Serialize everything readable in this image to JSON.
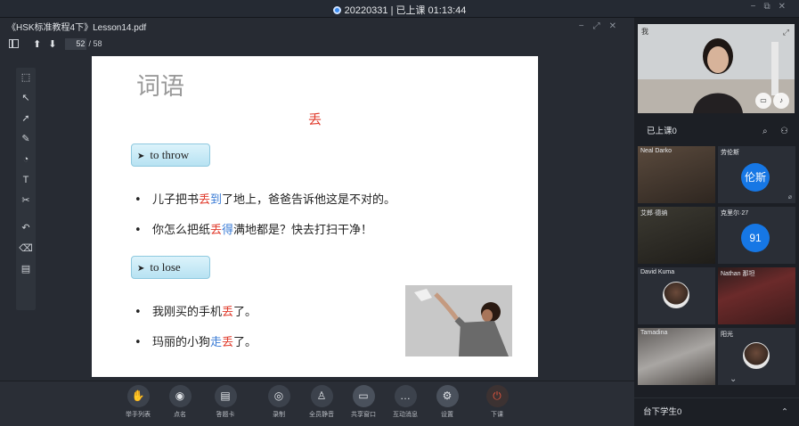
{
  "titlebar": {
    "session": "20220331 | 已上课 01:13:44"
  },
  "pdf": {
    "filename": "《HSK标准教程4下》Lesson14.pdf",
    "page_current": "52",
    "page_total": "/ 58"
  },
  "slide": {
    "title": "词语",
    "word": "丢",
    "meaning1": "to throw",
    "meaning2": "to lose",
    "s1": {
      "a": "儿子把书",
      "b": "丢",
      "c": "到",
      "d": "了地上，爸爸告诉他这是不对的。"
    },
    "s2": {
      "a": "你怎么把纸",
      "b": "丢",
      "c": "得",
      "d": "满地都是？快去打扫干净！"
    },
    "s3": {
      "a": "我刚买的手机",
      "b": "丢",
      "d": "了。"
    },
    "s4": {
      "a": "玛丽的小狗",
      "c": "走",
      "b": "丢",
      "d": "了。"
    }
  },
  "bottombar": {
    "items": [
      {
        "label": "举手列表",
        "icon": "hand-icon"
      },
      {
        "label": "点名",
        "icon": "location-icon"
      },
      {
        "label": "答题卡",
        "icon": "answer-card-icon"
      },
      {
        "label": "录制",
        "icon": "record-icon"
      },
      {
        "label": "全员静音",
        "icon": "mute-all-icon"
      },
      {
        "label": "共享窗口",
        "icon": "share-screen-icon"
      },
      {
        "label": "互动消息",
        "icon": "chat-icon"
      },
      {
        "label": "设置",
        "icon": "gear-icon"
      },
      {
        "label": "下课",
        "icon": "power-icon"
      }
    ]
  },
  "right": {
    "teacher_label": "我",
    "seated": "已上课0",
    "students": [
      {
        "name": "Neal Darko",
        "type": "video"
      },
      {
        "name": "劳伦斯",
        "type": "avatar",
        "avatar_text": "伦斯"
      },
      {
        "name": "艾郎·德纳",
        "type": "video"
      },
      {
        "name": "克里尔·27",
        "type": "avatar",
        "avatar_text": "91"
      },
      {
        "name": "David Kuma",
        "type": "photo"
      },
      {
        "name": "Nathan 那坦",
        "type": "video"
      },
      {
        "name": "Tamadina",
        "type": "video"
      },
      {
        "name": "阳光",
        "type": "photo"
      }
    ],
    "offstage": "台下学生0"
  }
}
